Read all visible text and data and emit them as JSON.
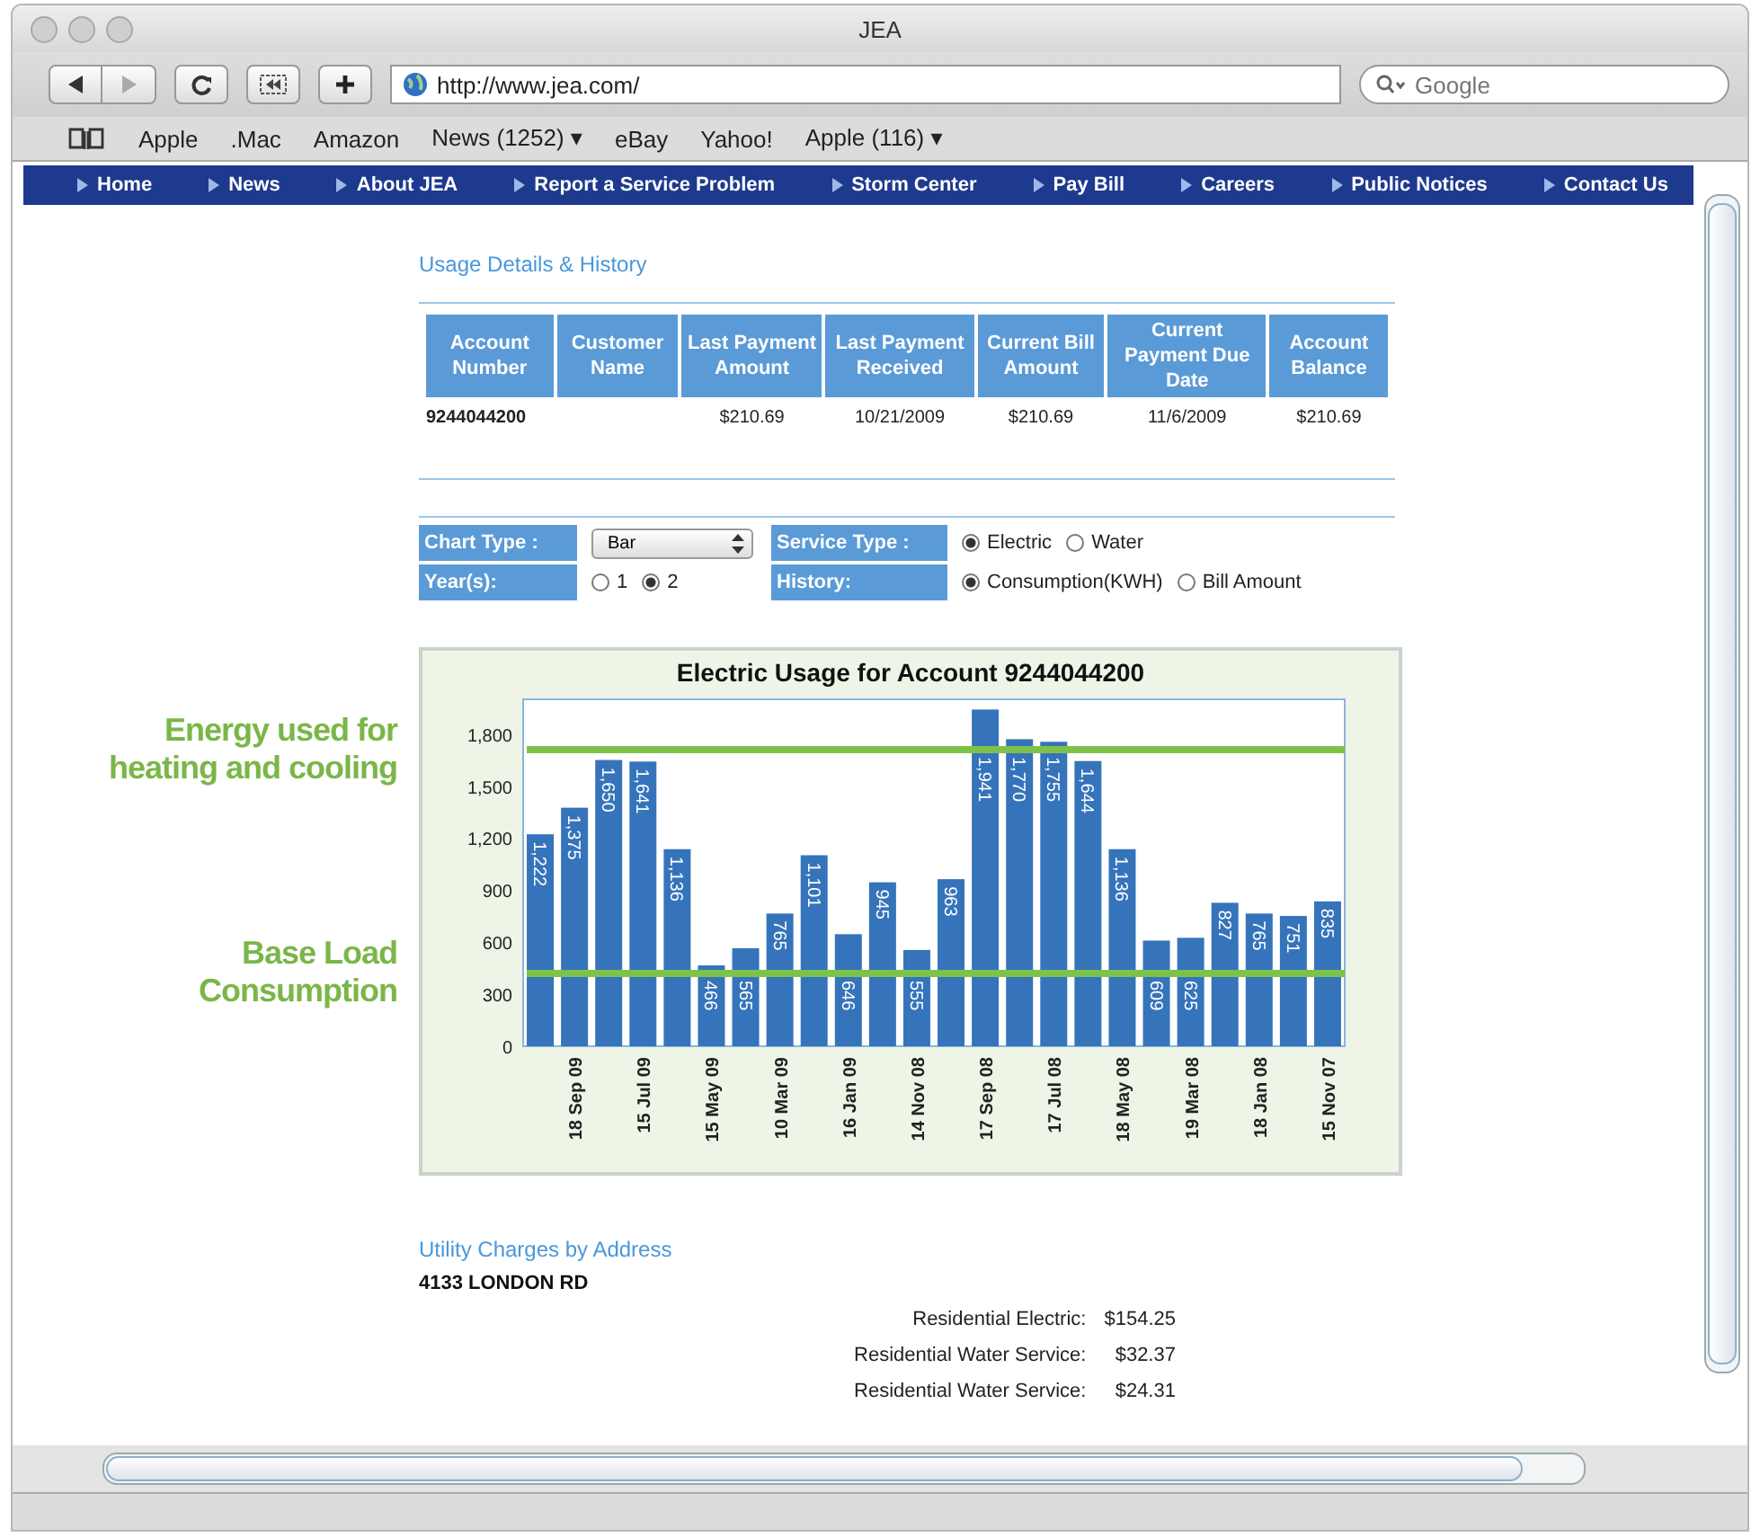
{
  "window": {
    "title": "JEA"
  },
  "toolbar": {
    "url": "http://www.jea.com/",
    "search_placeholder": "Google"
  },
  "bookmarks": [
    "Apple",
    ".Mac",
    "Amazon",
    "News (1252) ▾",
    "eBay",
    "Yahoo!",
    "Apple (116) ▾"
  ],
  "nav": [
    "Home",
    "News",
    "About JEA",
    "Report a Service Problem",
    "Storm Center",
    "Pay Bill",
    "Careers",
    "Public Notices",
    "Contact Us"
  ],
  "usage": {
    "heading": "Usage Details & History",
    "columns": [
      {
        "label": "Account Number",
        "value": "9244044200"
      },
      {
        "label": "Customer Name"
      },
      {
        "label": "Last Payment Amount",
        "value": "$210.69"
      },
      {
        "label": "Last Payment Received",
        "value": "10/21/2009"
      },
      {
        "label": "Current Bill Amount",
        "value": "$210.69"
      },
      {
        "label": "Current Payment Due Date",
        "value": "11/6/2009"
      },
      {
        "label": "Account Balance",
        "value": "$210.69"
      }
    ]
  },
  "form": {
    "chart_type": {
      "label": "Chart Type :",
      "value": "Bar"
    },
    "years": {
      "label": "Year(s):",
      "options": [
        {
          "label": "1",
          "selected": false
        },
        {
          "label": "2",
          "selected": true
        }
      ]
    },
    "service_type": {
      "label": "Service Type :",
      "options": [
        {
          "label": "Electric",
          "selected": true
        },
        {
          "label": "Water",
          "selected": false
        }
      ]
    },
    "history": {
      "label": "History:",
      "options": [
        {
          "label": "Consumption(KWH)",
          "selected": true
        },
        {
          "label": "Bill Amount",
          "selected": false
        }
      ]
    }
  },
  "chart_data": {
    "type": "bar",
    "title": "Electric Usage for Account 9244044200",
    "categories": [
      null,
      "18 Sep 09",
      null,
      "15 Jul 09",
      null,
      "15 May 09",
      null,
      "10 Mar 09",
      null,
      "16 Jan 09",
      null,
      "14 Nov 08",
      null,
      "17 Sep 08",
      null,
      "17 Jul 08",
      null,
      "18 May 08",
      null,
      "19 Mar 08",
      null,
      "18 Jan 08",
      null,
      "15 Nov 07"
    ],
    "values": [
      1222,
      1375,
      1650,
      1641,
      1136,
      466,
      565,
      765,
      1101,
      646,
      945,
      555,
      963,
      1941,
      1770,
      1755,
      1644,
      1136,
      609,
      625,
      827,
      765,
      751,
      835
    ],
    "ylim": [
      0,
      2000
    ],
    "yticks": [
      0,
      300,
      600,
      900,
      {
        "value": 1200,
        "label": "1,200"
      },
      {
        "value": 1500,
        "label": "1,500"
      },
      {
        "value": 1800,
        "label": "1,800"
      }
    ],
    "value_labels": [
      "1,222",
      "1,375",
      "1,650",
      "1,641",
      "1,136",
      "466",
      "565",
      "765",
      "1,101",
      "646",
      "945",
      "555",
      "963",
      "1,941",
      "1,770",
      "1,755",
      "1,644",
      "1,136",
      "609",
      "625",
      "827",
      "765",
      "751",
      "835"
    ],
    "ref_lines": [
      {
        "axis": "y",
        "value": 1710,
        "label": "Energy used for heating and cooling"
      },
      {
        "axis": "y",
        "value": 420,
        "label": "Base Load Consumption"
      }
    ]
  },
  "charges": {
    "heading": "Utility Charges by Address",
    "address": "4133 LONDON RD",
    "items": [
      {
        "label": "Residential Electric:",
        "amount": "$154.25"
      },
      {
        "label": "Residential Water Service:",
        "amount": "$32.37"
      },
      {
        "label": "Residential Water Service:",
        "amount": "$24.31"
      }
    ]
  }
}
